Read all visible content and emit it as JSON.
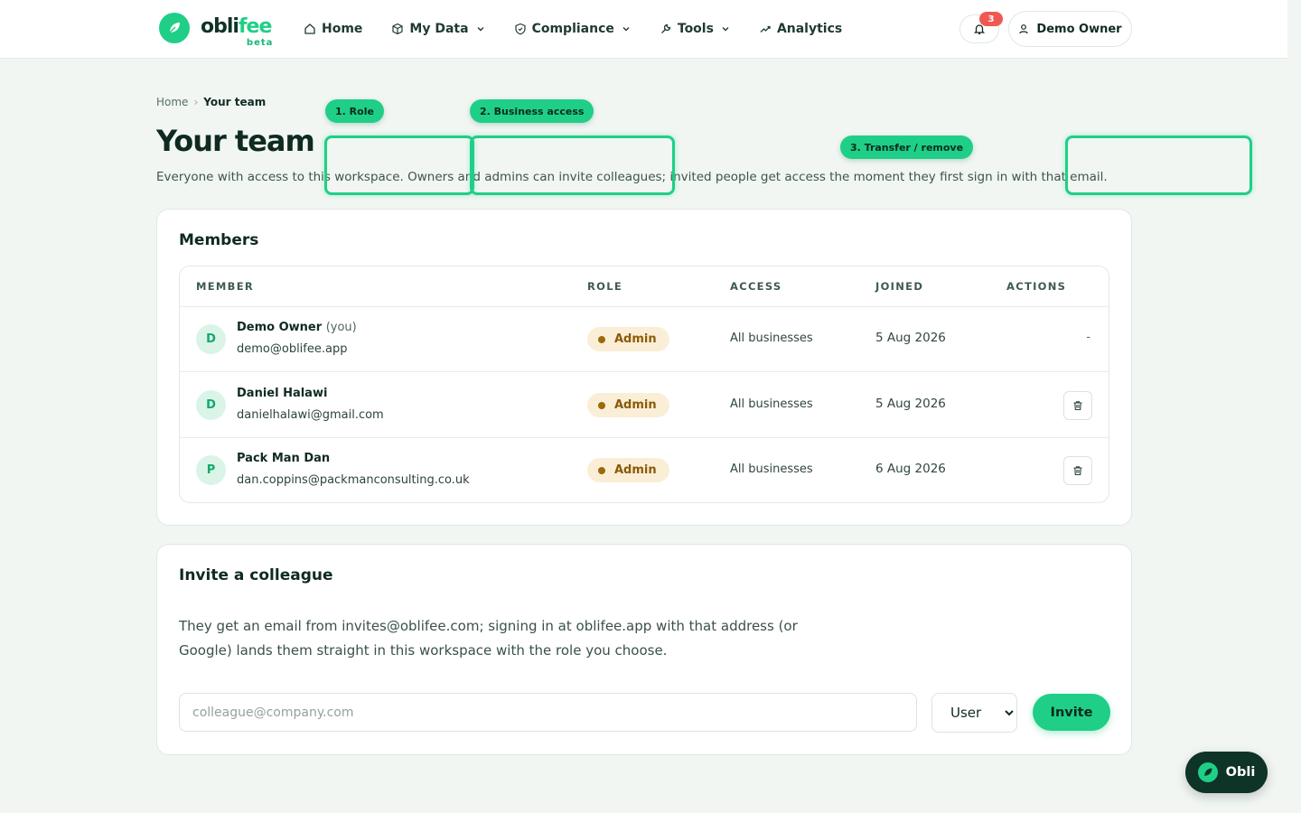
{
  "brand": {
    "name_main": "obli",
    "name_accent": "fee",
    "beta": "beta"
  },
  "nav": {
    "items": [
      {
        "label": "Home",
        "icon": "home-icon",
        "has_dropdown": false
      },
      {
        "label": "My Data",
        "icon": "cube-icon",
        "has_dropdown": true
      },
      {
        "label": "Compliance",
        "icon": "shield-icon",
        "has_dropdown": true
      },
      {
        "label": "Tools",
        "icon": "wrench-icon",
        "has_dropdown": true
      },
      {
        "label": "Analytics",
        "icon": "trend-icon",
        "has_dropdown": false
      }
    ],
    "notifications_count": "3",
    "user_label": "Demo Owner"
  },
  "breadcrumb": {
    "home": "Home",
    "separator": "›",
    "current": "Your team"
  },
  "page": {
    "title": "Your team",
    "description": "Everyone with access to this workspace. Owners and admins can invite colleagues; invited people get access the moment they first sign in with that email."
  },
  "tour": {
    "step1": "1. Role",
    "step2": "2. Business access",
    "step3": "3. Transfer / remove"
  },
  "members": {
    "title": "Members",
    "columns": {
      "member": "MEMBER",
      "role": "ROLE",
      "access": "ACCESS",
      "joined": "JOINED",
      "actions": "ACTIONS"
    },
    "rows": [
      {
        "initial": "D",
        "name": "Demo Owner",
        "you": "(you)",
        "email": "demo@oblifee.app",
        "role": "Admin",
        "access": "All businesses",
        "joined": "5 Aug 2026",
        "action": "-"
      },
      {
        "initial": "D",
        "name": "Daniel Halawi",
        "you": "",
        "email": "danielhalawi@gmail.com",
        "role": "Admin",
        "access": "All businesses",
        "joined": "5 Aug 2026",
        "action": "delete"
      },
      {
        "initial": "P",
        "name": "Pack Man Dan",
        "you": "",
        "email": "dan.coppins@packmanconsulting.co.uk",
        "role": "Admin",
        "access": "All businesses",
        "joined": "6 Aug 2026",
        "action": "delete"
      }
    ]
  },
  "invite": {
    "title": "Invite a colleague",
    "description": "They get an email from invites@oblifee.com; signing in at oblifee.app with that address (or Google) lands them straight in this workspace with the role you choose.",
    "email_placeholder": "colleague@company.com",
    "role_selected": "User",
    "button": "Invite"
  },
  "assistant": {
    "label": "Obli"
  },
  "colors": {
    "accent": "#1fcf87",
    "dark": "#0e3327",
    "admin_badge_bg": "#fbeed7",
    "admin_badge_text": "#8a5a06",
    "notification": "#ee5a52"
  }
}
